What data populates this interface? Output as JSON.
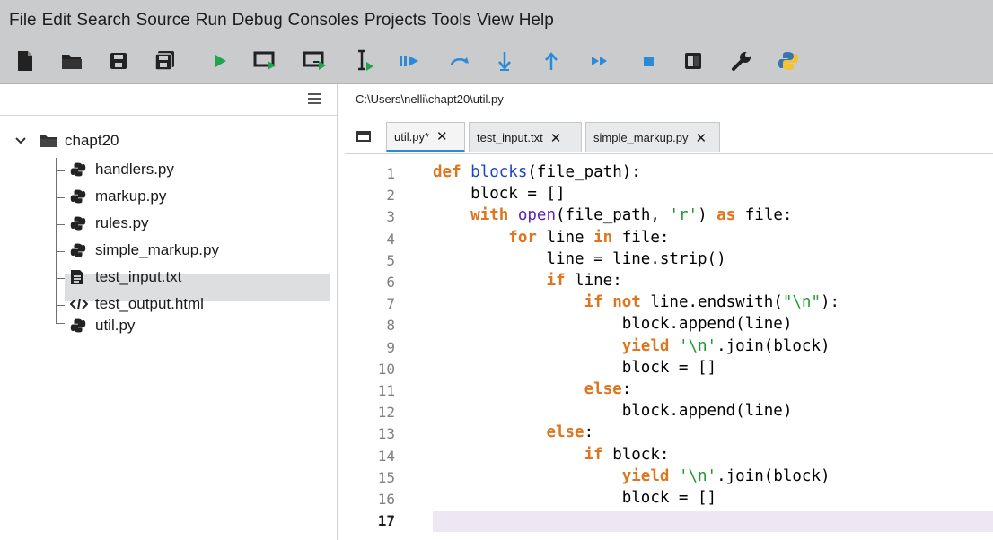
{
  "menu": [
    "File",
    "Edit",
    "Search",
    "Source",
    "Run",
    "Debug",
    "Consoles",
    "Projects",
    "Tools",
    "View",
    "Help"
  ],
  "toolbar": {
    "icons": [
      "new-file-icon",
      "open-folder-icon",
      "save-icon",
      "save-all-icon",
      "run-icon",
      "run-cell-icon",
      "run-cell-advance-icon",
      "run-selection-icon",
      "debug-icon",
      "step-over-icon",
      "step-into-icon",
      "step-return-icon",
      "continue-icon",
      "stop-icon",
      "maximize-pane-icon",
      "preferences-wrench-icon",
      "python-path-icon"
    ],
    "colors": {
      "green": "#1fa54b",
      "blue": "#2b8ad8",
      "dark": "#222222"
    }
  },
  "file_path": "C:\\Users\\nelli\\chapt20\\util.py",
  "tabs": [
    {
      "label": "util.py*",
      "close": "✕",
      "active": true
    },
    {
      "label": "test_input.txt",
      "close": "✕",
      "active": false
    },
    {
      "label": "simple_markup.py",
      "close": "✕",
      "active": false
    }
  ],
  "tree": {
    "root": "chapt20",
    "items": [
      {
        "label": "handlers.py",
        "icon": "python-file-icon"
      },
      {
        "label": "markup.py",
        "icon": "python-file-icon"
      },
      {
        "label": "rules.py",
        "icon": "python-file-icon"
      },
      {
        "label": "simple_markup.py",
        "icon": "python-file-icon",
        "selected": true
      },
      {
        "label": "test_input.txt",
        "icon": "text-file-icon"
      },
      {
        "label": "test_output.html",
        "icon": "html-file-icon"
      },
      {
        "label": "util.py",
        "icon": "python-file-icon"
      }
    ]
  },
  "editor": {
    "current_line": 17,
    "line_numbers": [
      "1",
      "2",
      "3",
      "4",
      "5",
      "6",
      "7",
      "8",
      "9",
      "10",
      "11",
      "12",
      "13",
      "14",
      "15",
      "16",
      "17"
    ],
    "lines": [
      "def blocks(file_path):",
      "    block = []",
      "    with open(file_path, 'r') as file:",
      "        for line in file:",
      "            line = line.strip()",
      "            if line:",
      "                if not line.endswith(\"\\n\"):",
      "                    block.append(line)",
      "                    yield '\\n'.join(block)",
      "                    block = []",
      "                else:",
      "                    block.append(line)",
      "            else:",
      "                if block:",
      "                    yield '\\n'.join(block)",
      "                    block = []",
      ""
    ]
  }
}
